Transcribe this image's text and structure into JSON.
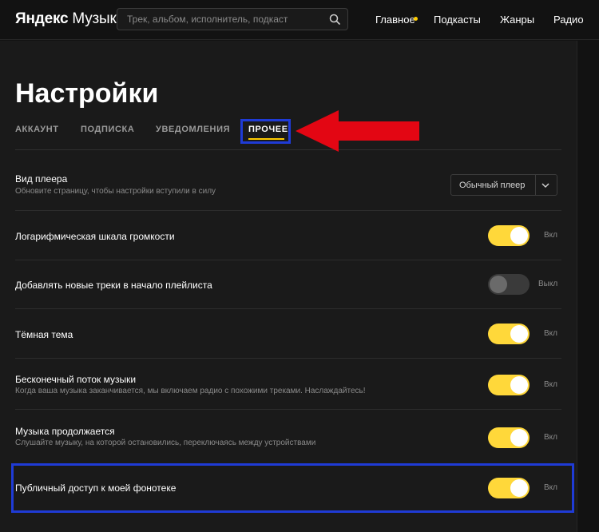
{
  "header": {
    "logo_brand": "Яндекс",
    "logo_product": "Музыка",
    "search_placeholder": "Трек, альбом, исполнитель, подкаст",
    "nav": [
      "Главное",
      "Подкасты",
      "Жанры",
      "Радио"
    ]
  },
  "settings": {
    "title": "Настройки",
    "tabs": [
      {
        "label": "АККАУНТ",
        "active": false
      },
      {
        "label": "ПОДПИСКА",
        "active": false
      },
      {
        "label": "УВЕДОМЛЕНИЯ",
        "active": false
      },
      {
        "label": "ПРОЧЕЕ",
        "active": true
      }
    ],
    "player": {
      "title": "Вид плеера",
      "subtitle": "Обновите страницу, чтобы настройки вступили в силу",
      "selected": "Обычный плеер"
    },
    "rows": [
      {
        "title": "Логарифмическая шкала громкости",
        "subtitle": "",
        "state": "on",
        "label": "Вкл"
      },
      {
        "title": "Добавлять новые треки в начало плейлиста",
        "subtitle": "",
        "state": "off",
        "label": "Выкл"
      },
      {
        "title": "Тёмная тема",
        "subtitle": "",
        "state": "on",
        "label": "Вкл"
      },
      {
        "title": "Бесконечный поток музыки",
        "subtitle": "Когда ваша музыка заканчивается, мы включаем радио с похожими треками. Наслаждайтесь!",
        "state": "on",
        "label": "Вкл"
      },
      {
        "title": "Музыка продолжается",
        "subtitle": "Слушайте музыку, на которой остановились, переключаясь между устройствами",
        "state": "on",
        "label": "Вкл"
      },
      {
        "title": "Публичный доступ к моей фонотеке",
        "subtitle": "",
        "state": "on",
        "label": "Вкл"
      }
    ]
  },
  "colors": {
    "accent": "#ffd83a",
    "nav_dot": "#ffcc00",
    "annotation_box": "#1f3bd6",
    "annotation_arrow": "#e30613"
  }
}
